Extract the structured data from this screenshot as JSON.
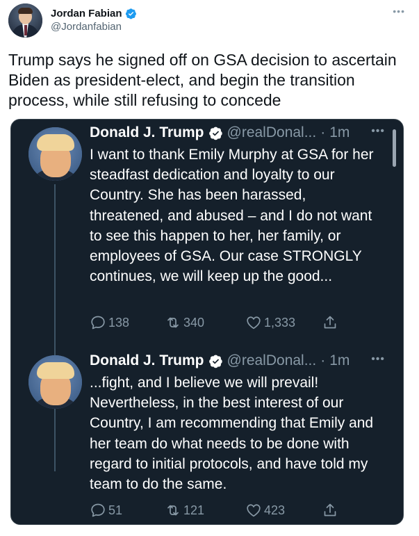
{
  "author": {
    "display_name": "Jordan Fabian",
    "handle": "@Jordanfabian"
  },
  "tweet": {
    "text": "Trump says he signed off on GSA decision to ascertain Biden as president-elect, and begin the transition process, while still refusing to concede"
  },
  "menu_glyph": "•••",
  "quoted_thread": [
    {
      "display_name": "Donald J. Trump",
      "handle": "@realDonal...",
      "separator": "·",
      "time": "1m",
      "text": "I want to thank Emily Murphy at GSA for her steadfast dedication and loyalty to our Country. She has been harassed, threatened, and abused – and I do not want to see this happen to her, her family, or employees of GSA. Our case STRONGLY continues, we will keep up the good...",
      "replies": "138",
      "retweets": "340",
      "likes": "1,333"
    },
    {
      "display_name": "Donald J. Trump",
      "handle": "@realDonal...",
      "separator": "·",
      "time": "1m",
      "text": "...fight, and I believe we will prevail! Nevertheless, in the best interest of our Country, I am recommending that Emily and her team do what needs to be done with regard to initial protocols, and have told my team to do the same.",
      "replies": "51",
      "retweets": "121",
      "likes": "423"
    }
  ],
  "colors": {
    "card_background": "#15202b",
    "verified_blue": "#1d9bf0",
    "muted_text": "#8899a6"
  },
  "icons": {
    "reply": "reply-icon",
    "retweet": "retweet-icon",
    "like": "heart-icon",
    "share": "share-icon",
    "verified": "verified-badge-icon",
    "more": "more-icon"
  }
}
